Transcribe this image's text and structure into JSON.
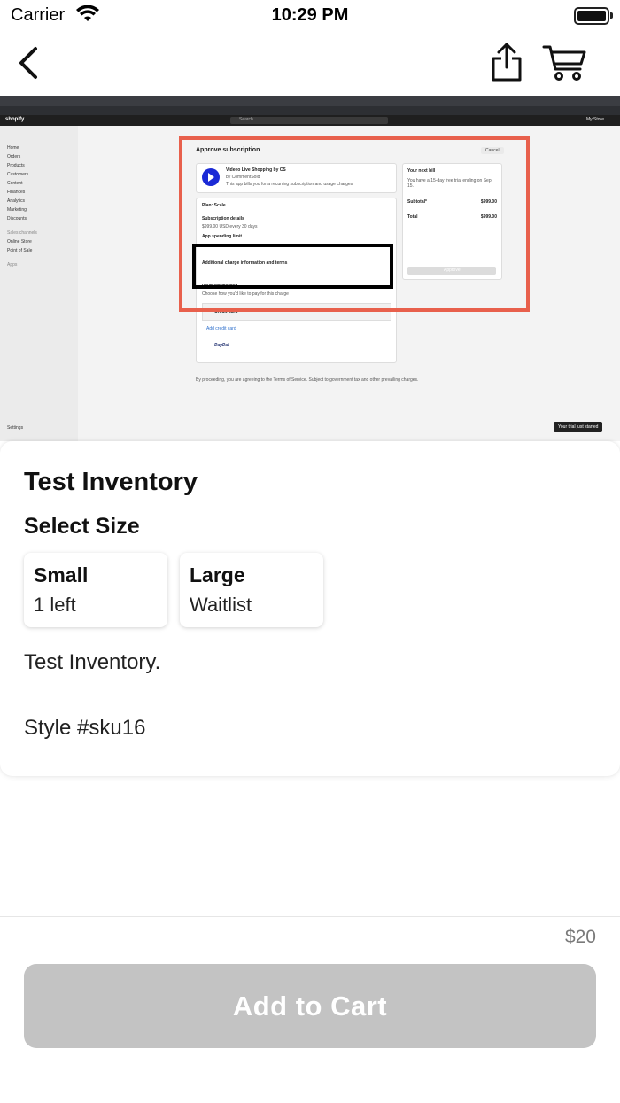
{
  "status_bar": {
    "carrier": "Carrier",
    "time": "10:29 PM"
  },
  "product": {
    "name": "Test Inventory",
    "select_size_label": "Select Size",
    "sizes": [
      {
        "name": "Small",
        "stock": "1 left"
      },
      {
        "name": "Large",
        "stock": "Waitlist"
      }
    ],
    "description": "Test Inventory.",
    "style": "Style #sku16",
    "price": "$20",
    "add_to_cart": "Add to Cart"
  },
  "screenshot": {
    "sidebar": [
      "Home",
      "Orders",
      "Products",
      "Customers",
      "Content",
      "Finances",
      "Analytics",
      "Marketing",
      "Discounts"
    ],
    "sales_channels_label": "Sales channels",
    "channels": [
      "Online Store",
      "Point of Sale"
    ],
    "apps_label": "Apps",
    "settings_label": "Settings",
    "heading": "Approve subscription",
    "cancel": "Cancel",
    "app_name": "Videeo Live Shopping by CS",
    "app_by": "by CommentSold",
    "app_desc": "This app bills you for a recurring subscription and usage charges",
    "plan": "Plan: Scale",
    "sub_details": "Subscription details",
    "sub_price": "$999.00 USD every 30 days",
    "spending_limit": "App spending limit",
    "extra_info": "Additional charge information and terms",
    "payment_method": "Payment method",
    "payment_hint": "Choose how you'd like to pay for this charge",
    "credit_card": "Credit card",
    "add_card": "Add credit card",
    "paypal": "PayPal",
    "next_bill": "Your next bill",
    "trial_text": "You have a 15-day free trial ending on Sep 15.",
    "subtotal": "Subtotal*",
    "subtotal_val": "$999.00",
    "total": "Total",
    "total_val": "$999.00",
    "approve": "Approve",
    "footer": "By proceeding, you are agreeing to the Terms of Service. Subject to government tax and other prevailing charges.",
    "toast": "Your trial just started",
    "store": "My Store",
    "search": "Search"
  },
  "colors": {
    "highlight": "#e8604c",
    "button_disabled": "#c3c3c3",
    "price": "#7a7a7a"
  }
}
